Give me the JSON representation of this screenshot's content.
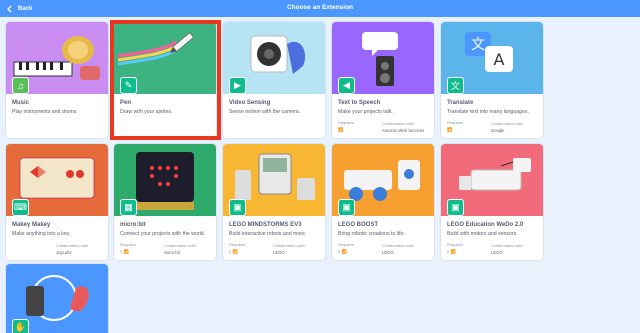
{
  "header": {
    "back_label": "Back",
    "title": "Choose an Extension"
  },
  "cards": [
    {
      "name": "Music",
      "desc": "Play instruments and drums.",
      "requires": "",
      "collab_label": "",
      "collab": "",
      "color": "#c98cf0",
      "badge": "#59c059",
      "badge_icon": "♫"
    },
    {
      "name": "Pen",
      "desc": "Draw with your sprites.",
      "requires": "",
      "collab_label": "",
      "collab": "",
      "color": "#3cb380",
      "badge": "#0fbd8c",
      "badge_icon": "✎"
    },
    {
      "name": "Video Sensing",
      "desc": "Sense motion with the camera.",
      "requires": "",
      "collab_label": "",
      "collab": "",
      "color": "#b7e4f5",
      "badge": "#0fbd8c",
      "badge_icon": "▶"
    },
    {
      "name": "Text to Speech",
      "desc": "Make your projects talk.",
      "requires": "Requires",
      "collab_label": "Collaboration with",
      "collab": "Amazon Web Services",
      "color": "#9966ff",
      "badge": "#0fbd8c",
      "badge_icon": "◀"
    },
    {
      "name": "Translate",
      "desc": "Translate text into many languages.",
      "requires": "Requires",
      "collab_label": "Collaboration with",
      "collab": "Google",
      "color": "#5bb5ea",
      "badge": "#0fbd8c",
      "badge_icon": "文"
    },
    {
      "name": "Makey Makey",
      "desc": "Make anything into a key.",
      "requires": "",
      "collab_label": "Collaboration with",
      "collab": "JoyLabz",
      "color": "#e56c3a",
      "badge": "#0fbd8c",
      "badge_icon": "⌨"
    },
    {
      "name": "micro:bit",
      "desc": "Connect your projects with the world.",
      "requires": "Requires",
      "collab_label": "Collaboration with",
      "collab": "micro:bit",
      "color": "#2eaa6b",
      "badge": "#0fbd8c",
      "badge_icon": "▦"
    },
    {
      "name": "LEGO MINDSTORMS EV3",
      "desc": "Build interactive robots and more.",
      "requires": "Requires",
      "collab_label": "Collaboration with",
      "collab": "LEGO",
      "color": "#f7b733",
      "badge": "#0fbd8c",
      "badge_icon": "▣"
    },
    {
      "name": "LEGO BOOST",
      "desc": "Bring robotic creations to life.",
      "requires": "Requires",
      "collab_label": "Collaboration with",
      "collab": "LEGO",
      "color": "#f7a032",
      "badge": "#0fbd8c",
      "badge_icon": "▣"
    },
    {
      "name": "LEGO Education WeDo 2.0",
      "desc": "Build with motors and sensors.",
      "requires": "Requires",
      "collab_label": "Collaboration with",
      "collab": "LEGO",
      "color": "#f26b7a",
      "badge": "#0fbd8c",
      "badge_icon": "▣"
    },
    {
      "name": "",
      "desc": "",
      "requires": "",
      "collab_label": "",
      "collab": "",
      "color": "#4c97ff",
      "badge": "#0fbd8c",
      "badge_icon": "✋"
    }
  ]
}
